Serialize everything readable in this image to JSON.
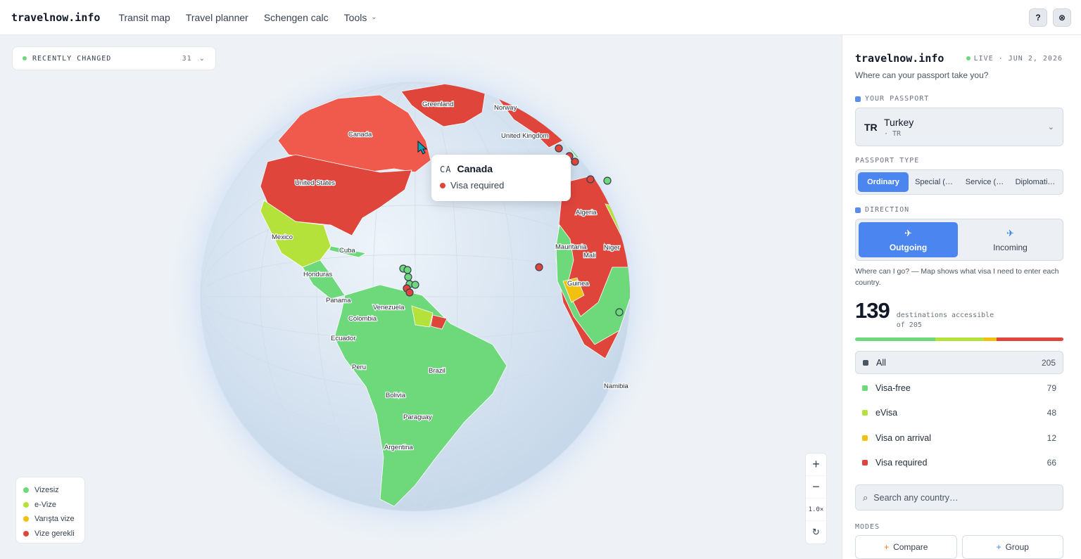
{
  "topbar": {
    "brand": "travelnow.info",
    "nav": [
      "Transit map",
      "Travel planner",
      "Schengen calc",
      "Tools"
    ],
    "help_label": "?",
    "close_label": "⊗"
  },
  "map": {
    "recently_changed_label": "RECENTLY CHANGED",
    "recently_changed_count": "31",
    "labels": {
      "greenland": "Greenland",
      "norway": "Norway",
      "canada": "Canada",
      "uk": "United Kingdom",
      "us": "United States",
      "mexico": "Mexico",
      "cuba": "Cuba",
      "honduras": "Honduras",
      "panama": "Panama",
      "venezuela": "Venezuela",
      "colombia": "Colombia",
      "ecuador": "Ecuador",
      "peru": "Peru",
      "brazil": "Brazil",
      "bolivia": "Bolivia",
      "paraguay": "Paraguay",
      "argentina": "Argentina",
      "algeria": "Algeria",
      "mauritania": "Mauritania",
      "mali": "Mali",
      "niger": "Niger",
      "guinea": "Guinea",
      "namibia": "Namibia"
    },
    "tooltip": {
      "code": "CA",
      "name": "Canada",
      "status": "Visa required"
    },
    "legend": [
      "Vizesiz",
      "e-Vize",
      "Varışta vize",
      "Vize gerekli"
    ],
    "zoom": {
      "in": "+",
      "out": "−",
      "level": "1.0×",
      "reset": "↻"
    }
  },
  "panel": {
    "brand": "travelnow.info",
    "live": "LIVE · JUN 2, 2026",
    "subtitle": "Where can your passport take you?",
    "passport_label": "YOUR PASSPORT",
    "passport": {
      "code": "TR",
      "name": "Turkey",
      "sub": "· TR"
    },
    "passport_type_label": "PASSPORT TYPE",
    "passport_types": [
      "Ordinary",
      "Special (…",
      "Service (…",
      "Diplomati…"
    ],
    "direction_label": "DIRECTION",
    "directions": [
      "Outgoing",
      "Incoming"
    ],
    "direction_desc": "Where can I go? — Map shows what visa I need to enter each country.",
    "destinations": {
      "count": "139",
      "label": "destinations accessible",
      "of": "of 205"
    },
    "filters": [
      {
        "label": "All",
        "count": "205"
      },
      {
        "label": "Visa-free",
        "count": "79"
      },
      {
        "label": "eVisa",
        "count": "48"
      },
      {
        "label": "Visa on arrival",
        "count": "12"
      },
      {
        "label": "Visa required",
        "count": "66"
      }
    ],
    "search_placeholder": "Search any country…",
    "modes_label": "MODES",
    "modes": [
      "Compare",
      "Group"
    ]
  },
  "colors": {
    "visa_free": "#6dd97a",
    "evisa": "#b5e23a",
    "on_arrival": "#f2c10f",
    "required": "#e0453c",
    "accent": "#4b86f0"
  }
}
